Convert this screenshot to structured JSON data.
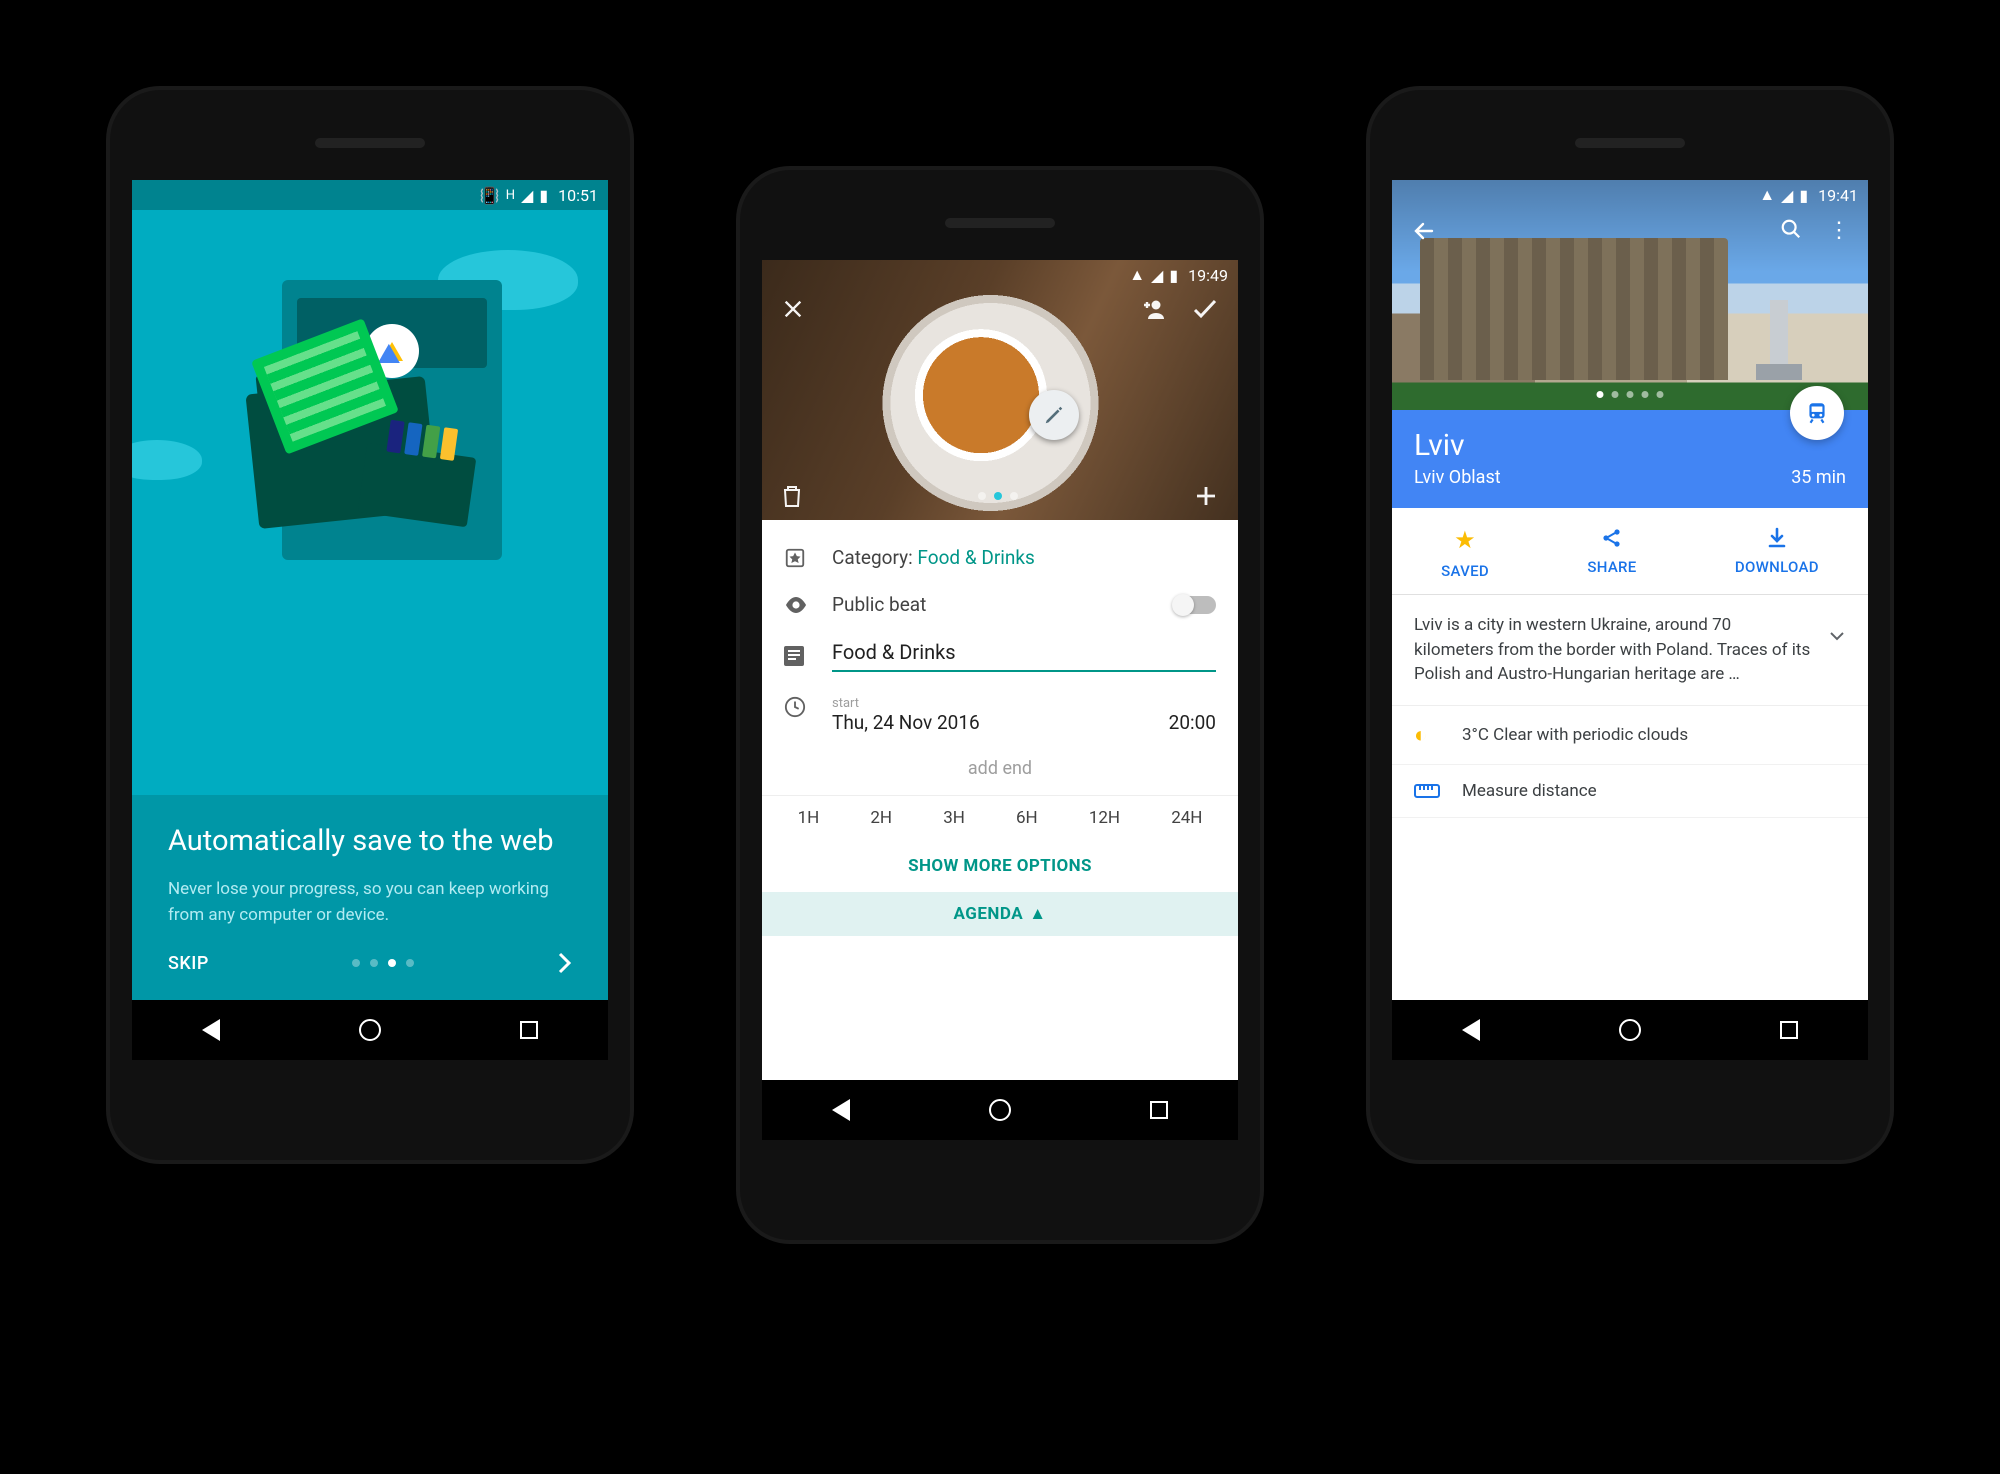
{
  "phoneLeft": {
    "status": {
      "time": "10:51",
      "icons": [
        "vibrate",
        "H",
        "signal",
        "battery"
      ]
    },
    "title": "Automatically save to the web",
    "desc": "Never lose your progress, so you can keep working from any computer or device.",
    "skip": "SKIP",
    "dot_active_index": 2,
    "dot_count": 4
  },
  "phoneCenter": {
    "status": {
      "time": "19:49",
      "icons": [
        "wifi",
        "signal",
        "battery"
      ]
    },
    "hero": {
      "page_active": 1,
      "page_count": 3
    },
    "category_label": "Category: ",
    "category_value": "Food & Drinks",
    "public_label": "Public beat",
    "name_value": "Food & Drinks",
    "start_label": "start",
    "start_date": "Thu, 24 Nov 2016",
    "start_time": "20:00",
    "add_end": "add end",
    "hours": [
      "1H",
      "2H",
      "3H",
      "6H",
      "12H",
      "24H"
    ],
    "show_more": "SHOW MORE OPTIONS",
    "agenda": "AGENDA"
  },
  "phoneRight": {
    "status": {
      "time": "19:41",
      "icons": [
        "wifi",
        "signal",
        "battery"
      ]
    },
    "hero": {
      "page_active": 0,
      "page_count": 5
    },
    "title": "Lviv",
    "subtitle": "Lviv Oblast",
    "travel_time": "35 min",
    "actions": {
      "saved": "SAVED",
      "share": "SHARE",
      "download": "DOWNLOAD"
    },
    "desc": "Lviv is a city in western Ukraine, around 70 kilometers from the border with Poland. Traces of its Polish and Austro-Hungarian heritage are …",
    "weather": "3°C Clear with periodic clouds",
    "measure": "Measure distance"
  }
}
